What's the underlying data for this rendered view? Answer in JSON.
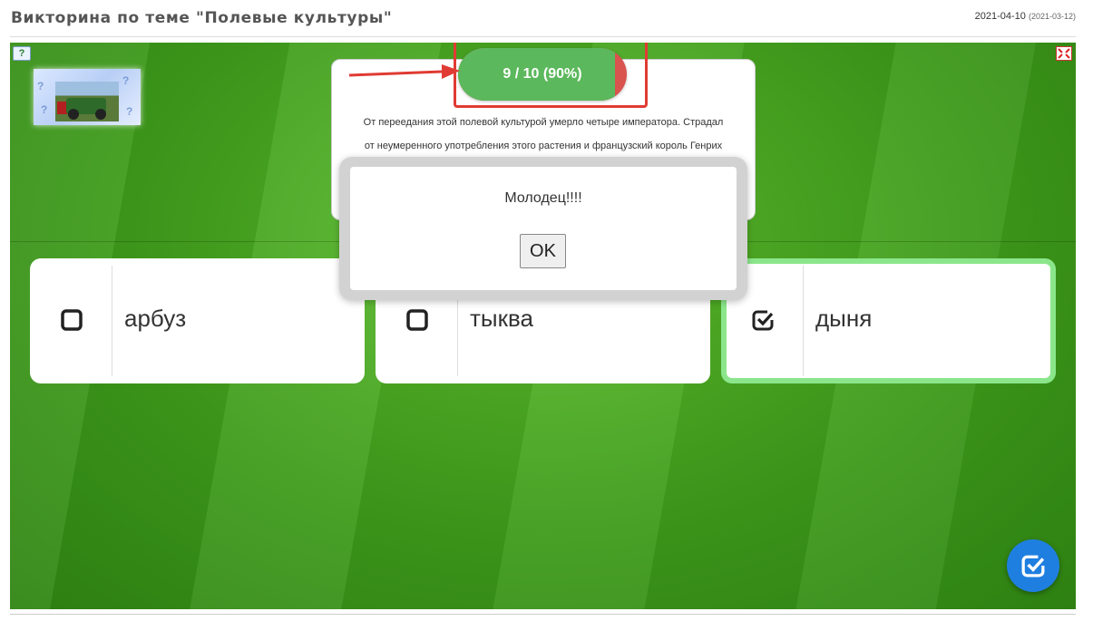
{
  "header": {
    "title": "Викторина по теме \"Полевые культуры\"",
    "date": "2021-04-10",
    "date_created": "(2021-03-12)"
  },
  "quiz": {
    "progress": {
      "label": "9 / 10 (90%)",
      "correct": 9,
      "total": 10,
      "percent": 90,
      "correct_color": "#5cb85c",
      "wrong_color": "#d9534f"
    },
    "question_lines": [
      "От переедания этой полевой культурой умерло четыре императора. Страдал",
      "от неумеренного употребления этого растения и французский король Генрих"
    ],
    "answers": [
      {
        "label": "арбуз",
        "checked": false,
        "icon": "square-checkbox-icon"
      },
      {
        "label": "тыква",
        "checked": false,
        "icon": "square-checkbox-icon"
      },
      {
        "label": "дыня",
        "checked": true,
        "icon": "checked-checkbox-icon",
        "highlight": "#8be68b"
      }
    ]
  },
  "dialog": {
    "message": "Молодец!!!!",
    "ok_label": "OK"
  },
  "icons": {
    "help": "help-icon",
    "fullscreen": "fullscreen-icon",
    "submit": "check-icon"
  },
  "colors": {
    "annotation_red": "#e03b33",
    "fab_blue": "#1f7fe0"
  }
}
